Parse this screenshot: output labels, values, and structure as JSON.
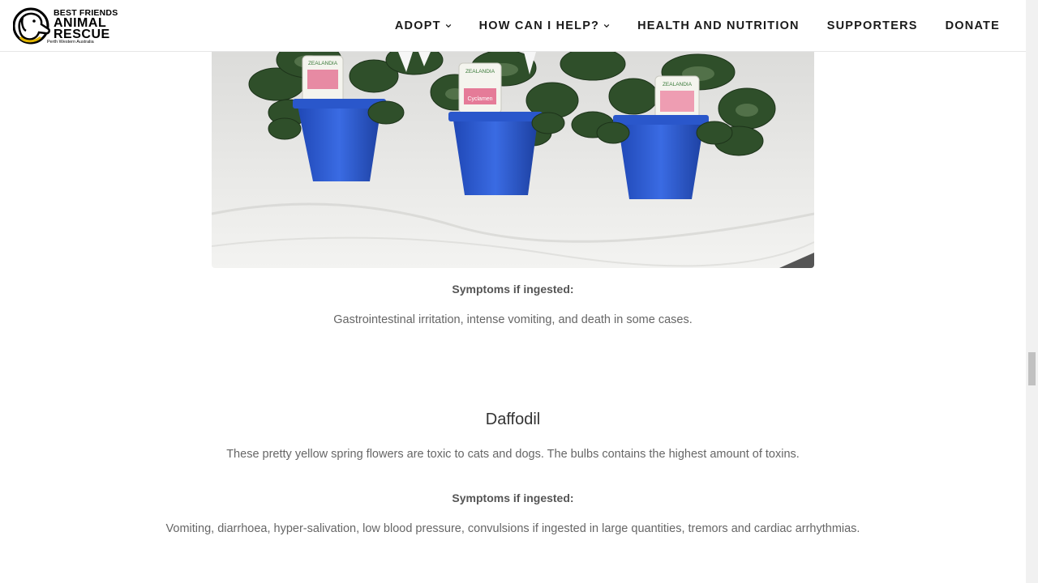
{
  "brand": {
    "line1": "BEST FRIENDS",
    "line2": "ANIMAL",
    "line3": "RESCUE",
    "line4": "Perth Western Australia"
  },
  "nav": {
    "items": [
      {
        "label": "ADOPT",
        "has_dropdown": true,
        "icon": "chevron-down-icon"
      },
      {
        "label": "HOW CAN I HELP?",
        "has_dropdown": true,
        "icon": "chevron-down-icon"
      },
      {
        "label": "HEALTH AND NUTRITION",
        "has_dropdown": false
      },
      {
        "label": "SUPPORTERS",
        "has_dropdown": false
      },
      {
        "label": "DONATE",
        "has_dropdown": false
      }
    ]
  },
  "cyclamen": {
    "symptoms_label": "Symptoms if ingested:",
    "symptoms_text": "Gastrointestinal irritation, intense vomiting, and death in some cases."
  },
  "photo": {
    "pot_tag": "ZEALANDIA",
    "plant_label": "Cyclamen"
  },
  "daffodil": {
    "title": "Daffodil",
    "description": "These pretty yellow spring flowers are toxic to cats and dogs. The bulbs contains the highest amount of toxins.",
    "symptoms_label": "Symptoms if ingested:",
    "symptoms_text": "Vomiting, diarrhoea, hyper-salivation, low blood pressure, convulsions if ingested in large quantities, tremors and cardiac arrhythmias."
  },
  "colors": {
    "pot_blue": "#2d5fd6",
    "leaf_green": "#2f4f2a",
    "text_gray": "#666666",
    "heading": "#333333"
  }
}
